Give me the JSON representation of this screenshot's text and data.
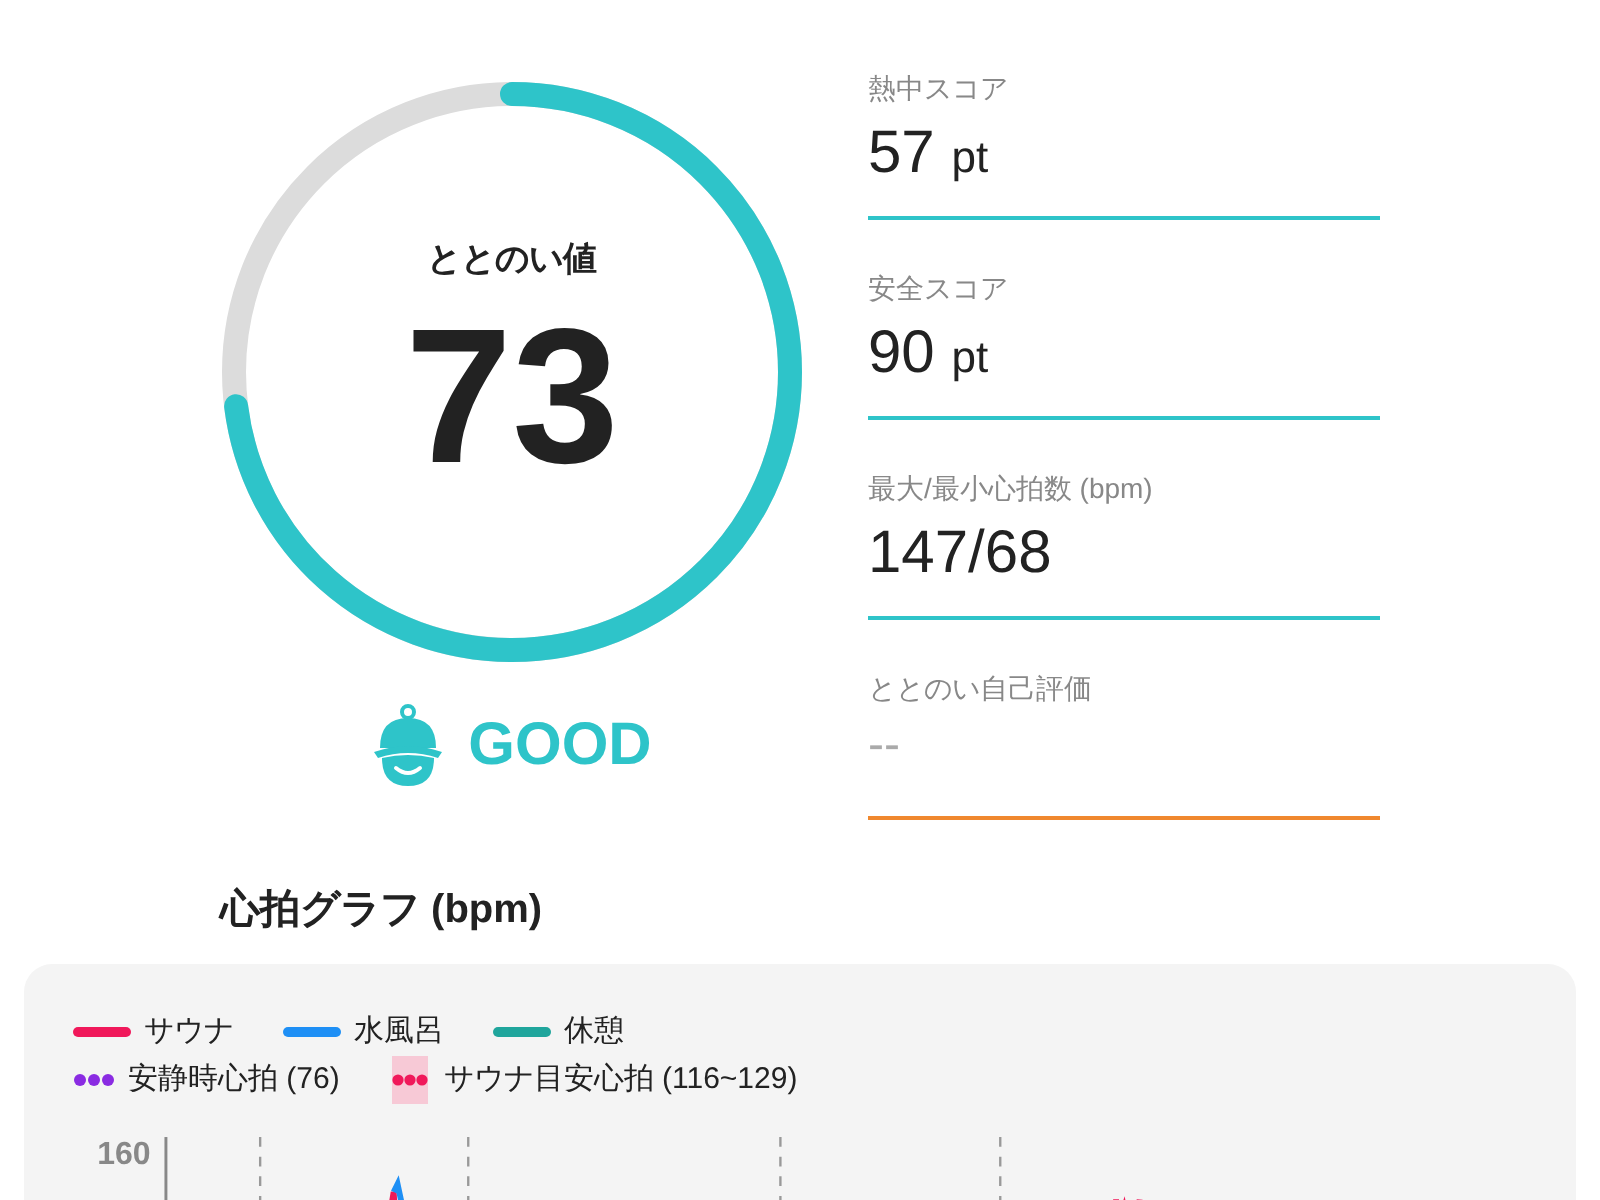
{
  "score": {
    "label": "ととのい値",
    "value": "73",
    "level": 0.73
  },
  "rating": {
    "label": "GOOD"
  },
  "metrics": [
    {
      "label": "熱中スコア",
      "value": "57",
      "unit": "pt",
      "color": "#2ec4c9",
      "placeholder": false
    },
    {
      "label": "安全スコア",
      "value": "90",
      "unit": "pt",
      "color": "#2ec4c9",
      "placeholder": false
    },
    {
      "label": "最大/最小心拍数 (bpm)",
      "value": "147/68",
      "color": "#2ec4c9",
      "placeholder": false
    },
    {
      "label": "ととのい自己評価",
      "value": "--",
      "color": "#f0882e",
      "placeholder": true
    }
  ],
  "heart_chart": {
    "title": "心拍グラフ (bpm)",
    "legend": [
      {
        "label": "サウナ",
        "color": "#f0185a",
        "kind": "line"
      },
      {
        "label": "水風呂",
        "color": "#1e8ff5",
        "kind": "line"
      },
      {
        "label": "休憩",
        "color": "#1fa59c",
        "kind": "line"
      },
      {
        "label": "安静時心拍 (76)",
        "color": "#8a2be2",
        "kind": "dots"
      },
      {
        "label": "サウナ目安心拍 (116~129)",
        "color": "#f0185a",
        "kind": "band"
      }
    ],
    "y_tick": "160"
  }
}
